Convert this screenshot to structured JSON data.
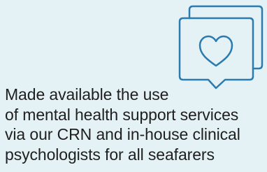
{
  "icons": {
    "illustration": "speech-bubbles-heart-icon",
    "stroke_color": "#2a7cb0",
    "background_color": "#e4f1f5"
  },
  "text": {
    "description": "Made available the use\nof mental health support services\nvia our CRN and in-house clinical\npsychologists for all seafarers"
  }
}
